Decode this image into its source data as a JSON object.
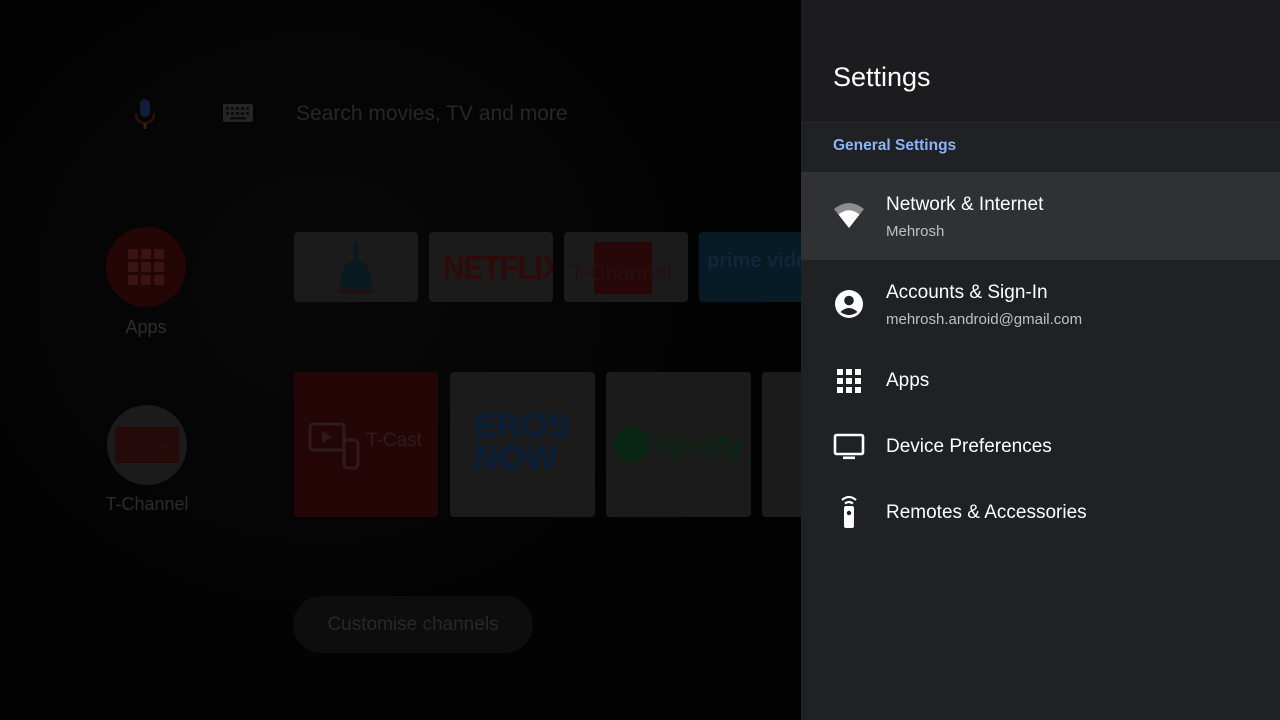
{
  "home": {
    "search_placeholder": "Search movies, TV and more",
    "apps_label": "Apps",
    "tchannel_label": "T-Channel",
    "tiles_row1": {
      "netflix": "NETFLIX",
      "tchannel": "T-Channel",
      "prime": "prime video"
    },
    "tiles_row2": {
      "tcast": "T-Cast",
      "eros_line1": "EROS",
      "eros_line2": "NOW",
      "spotify": "Spotify"
    },
    "customise_button": "Customise channels"
  },
  "settings": {
    "title": "Settings",
    "section": "General Settings",
    "items": [
      {
        "title": "Network & Internet",
        "subtitle": "Mehrosh",
        "icon": "wifi-icon",
        "selected": true
      },
      {
        "title": "Accounts & Sign-In",
        "subtitle": "mehrosh.android@gmail.com",
        "icon": "account-icon",
        "selected": false
      },
      {
        "title": "Apps",
        "subtitle": "",
        "icon": "apps-grid-icon",
        "selected": false
      },
      {
        "title": "Device Preferences",
        "subtitle": "",
        "icon": "tv-icon",
        "selected": false
      },
      {
        "title": "Remotes & Accessories",
        "subtitle": "",
        "icon": "remote-icon",
        "selected": false
      }
    ]
  },
  "colors": {
    "panel_bg": "#202124",
    "selected_bg": "#303134",
    "accent": "#8ab4f8"
  }
}
